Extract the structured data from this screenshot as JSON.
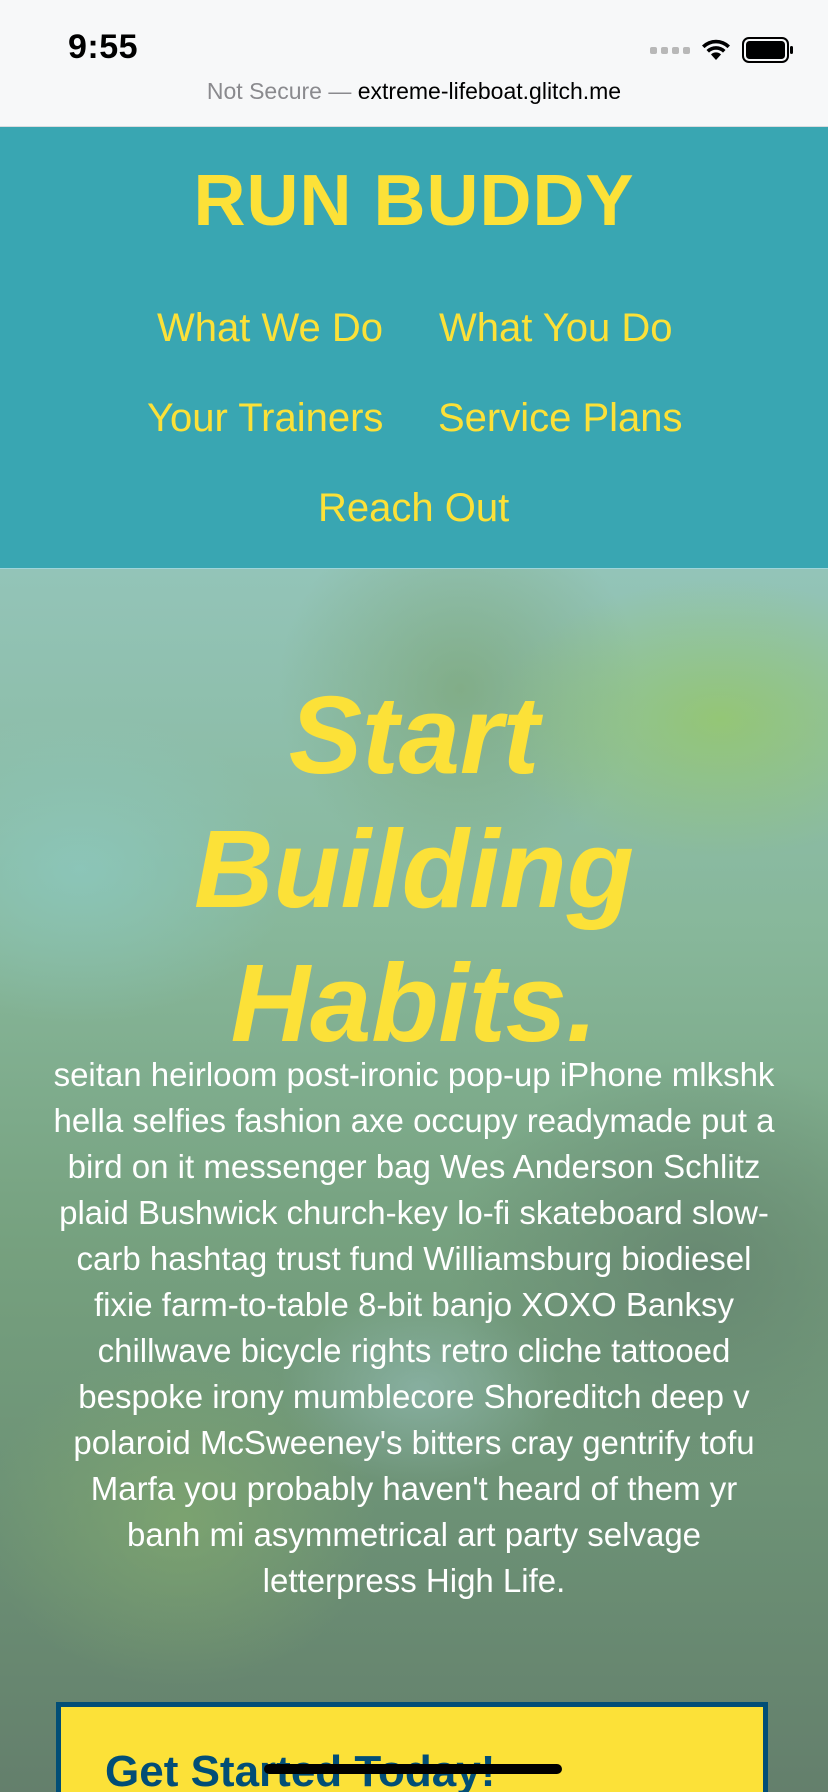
{
  "status_bar": {
    "time": "9:55",
    "url_security": "Not Secure",
    "url_separator": " — ",
    "url_domain": "extreme-lifeboat.glitch.me"
  },
  "header": {
    "title": "RUN BUDDY",
    "nav": [
      {
        "label": "What We Do"
      },
      {
        "label": "What You Do"
      },
      {
        "label": "Your Trainers"
      },
      {
        "label": "Service Plans"
      },
      {
        "label": "Reach Out"
      }
    ]
  },
  "hero": {
    "title_lines": [
      "Start",
      "Building",
      "Habits."
    ],
    "body": "seitan heirloom post-ironic pop-up iPhone mlkshk hella selfies fashion axe occupy readymade put a bird on it messenger bag Wes Anderson Schlitz plaid Bushwick church-key lo-fi skateboard slow-carb hashtag trust fund Williamsburg biodiesel fixie farm-to-table 8-bit banjo XOXO Banksy chillwave bicycle rights retro cliche tattooed bespoke irony mumblecore Shoreditch deep v polaroid McSweeney's bitters cray gentrify tofu Marfa you probably haven't heard of them yr banh mi asymmetrical art party selvage letterpress High Life."
  },
  "cta": {
    "title": "Get Started Today!"
  },
  "colors": {
    "header_bg": "#39a6b2",
    "accent_yellow": "#fce138",
    "cta_border": "#024e76"
  }
}
